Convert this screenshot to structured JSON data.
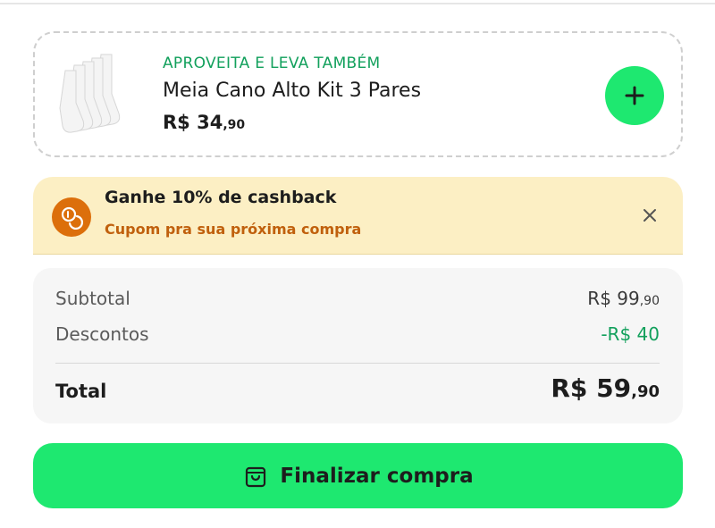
{
  "upsell": {
    "eyebrow": "APROVEITA E LEVA TAMBÉM",
    "product_name": "Meia Cano Alto Kit 3 Pares",
    "price_main": "R$ 34",
    "price_cents": ",90",
    "image_icon": "white-socks-image",
    "add_icon": "plus-icon"
  },
  "cashback": {
    "title": "Ganhe 10% de cashback",
    "subtitle": "Cupom pra sua próxima compra",
    "icon": "coins-icon",
    "close_icon": "close-icon"
  },
  "summary": {
    "subtotal_label": "Subtotal",
    "subtotal_main": "R$ 99",
    "subtotal_cents": ",90",
    "discount_label": "Descontos",
    "discount_value": "-R$ 40",
    "total_label": "Total",
    "total_main": "R$ 59",
    "total_cents": ",90"
  },
  "checkout": {
    "label": "Finalizar compra",
    "icon": "shopping-bag-icon"
  },
  "colors": {
    "accent_green": "#1ee870",
    "text_green": "#12a05c",
    "cashback_bg": "#fcefc4",
    "cashback_orange": "#dc6f0b"
  }
}
